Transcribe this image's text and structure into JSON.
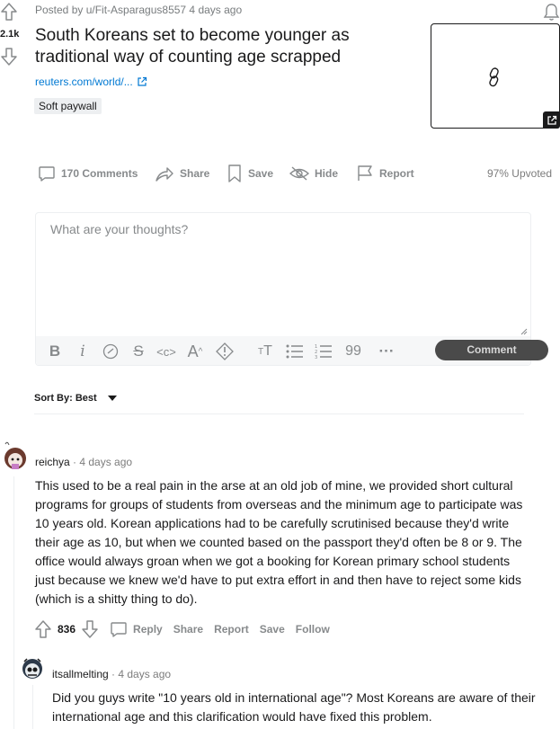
{
  "post": {
    "score": "2.1k",
    "meta": "Posted by u/Fit-Asparagus8557 4 days ago",
    "title": "South Koreans set to become younger as traditional way of counting age scrapped",
    "link_text": "reuters.com/world/...",
    "flair": "Soft paywall"
  },
  "actions": {
    "comments": "170 Comments",
    "share": "Share",
    "save": "Save",
    "hide": "Hide",
    "report": "Report",
    "upvoted": "97% Upvoted"
  },
  "editor": {
    "placeholder": "What are your thoughts?",
    "comment_button": "Comment",
    "toolbar_icons": [
      "bold-icon",
      "italic-icon",
      "link-icon",
      "strikethrough-icon",
      "inline-code-icon",
      "superscript-icon",
      "spoiler-icon",
      "heading-icon",
      "bulleted-list-icon",
      "numbered-list-icon",
      "quote-block-icon",
      "more-icon"
    ]
  },
  "sort": {
    "label": "Sort By: Best"
  },
  "comments": [
    {
      "user": "reichya",
      "time": " · 4 days ago",
      "body": "This used to be a real pain in the arse at an old job of mine, we provided short cultural programs for groups of students from overseas and the minimum age to participate was 10 years old. Korean applications had to be carefully scrutinised because they'd write their age as 10, but when we counted based on the passport they'd often be 8 or 9. The office would always groan when we got a booking for Korean primary school students just because we knew we'd have to put extra effort in and then have to reject some kids (which is a shitty thing to do).",
      "score": "836",
      "reply": "Reply",
      "share": "Share",
      "report": "Report",
      "save": "Save",
      "follow": "Follow"
    },
    {
      "user": "itsallmelting",
      "time": " · 4 days ago",
      "body": "Did you guys write \"10 years old in international age\"? Most Koreans are aware of their international age and this clarification would have fixed this problem."
    }
  ],
  "colors": {
    "text": "#1a1a1b",
    "muted": "#878a8c",
    "link": "#0079d3",
    "border": "#edeff1",
    "button": "#4a4a4a"
  }
}
